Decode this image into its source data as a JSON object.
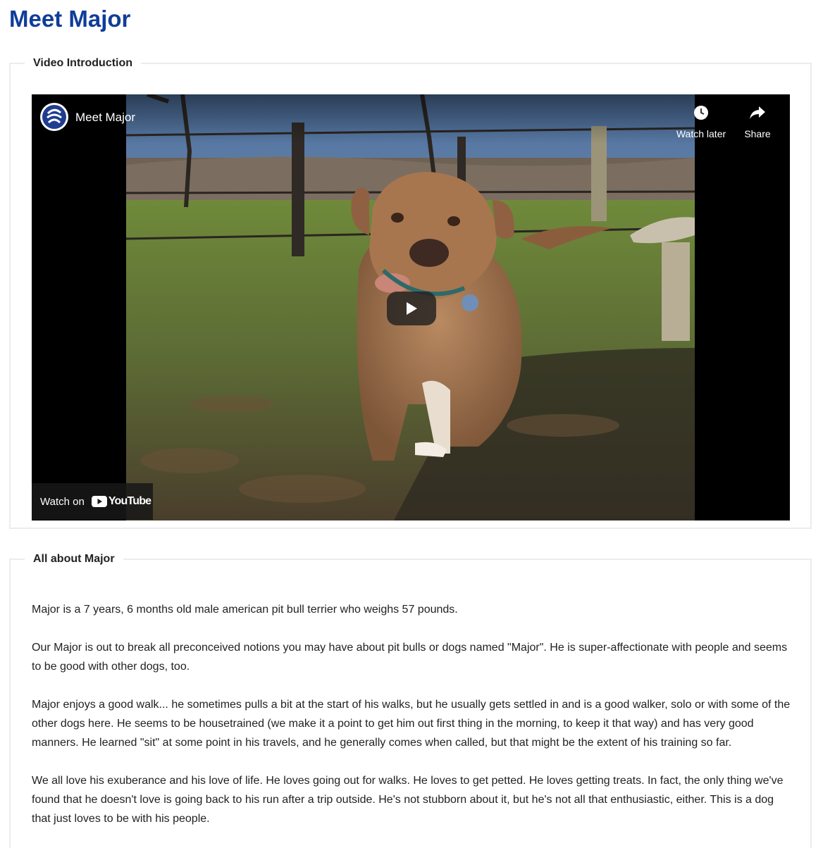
{
  "page": {
    "title": "Meet Major",
    "title_color": "#103d9a"
  },
  "video_section": {
    "legend": "Video Introduction",
    "player": {
      "video_title": "Meet Major",
      "channel_icon": "shelter-logo-icon",
      "watch_later_label": "Watch later",
      "watch_later_icon": "clock-icon",
      "share_label": "Share",
      "share_icon": "share-arrow-icon",
      "play_icon": "play-icon",
      "watch_on_label": "Watch on",
      "youtube_wordmark": "YouTube",
      "youtube_icon": "youtube-logo-icon"
    }
  },
  "about_section": {
    "legend": "All about Major",
    "paragraphs": [
      "Major is a 7 years, 6 months old male american pit bull terrier who weighs 57 pounds.",
      "Our Major is out to break all preconceived notions you may have about pit bulls or dogs named \"Major\". He is super-affectionate with people and seems to be good with other dogs, too.",
      "Major enjoys a good walk... he sometimes pulls a bit at the start of his walks, but he usually gets settled in and is a good walker, solo or with some of the other dogs here. He seems to be housetrained (we make it a point to get him out first thing in the morning, to keep it that way) and has very good manners. He learned \"sit\" at some point in his travels, and he generally comes when called, but that might be the extent of his training so far.",
      "We all love his exuberance and his love of life. He loves going out for walks. He loves to get petted. He loves getting treats. In fact, the only thing we've found that he doesn't love is going back to his run after a trip outside. He's not stubborn about it, but he's not all that enthusiastic, either. This is a dog that just loves to be with his people."
    ]
  }
}
